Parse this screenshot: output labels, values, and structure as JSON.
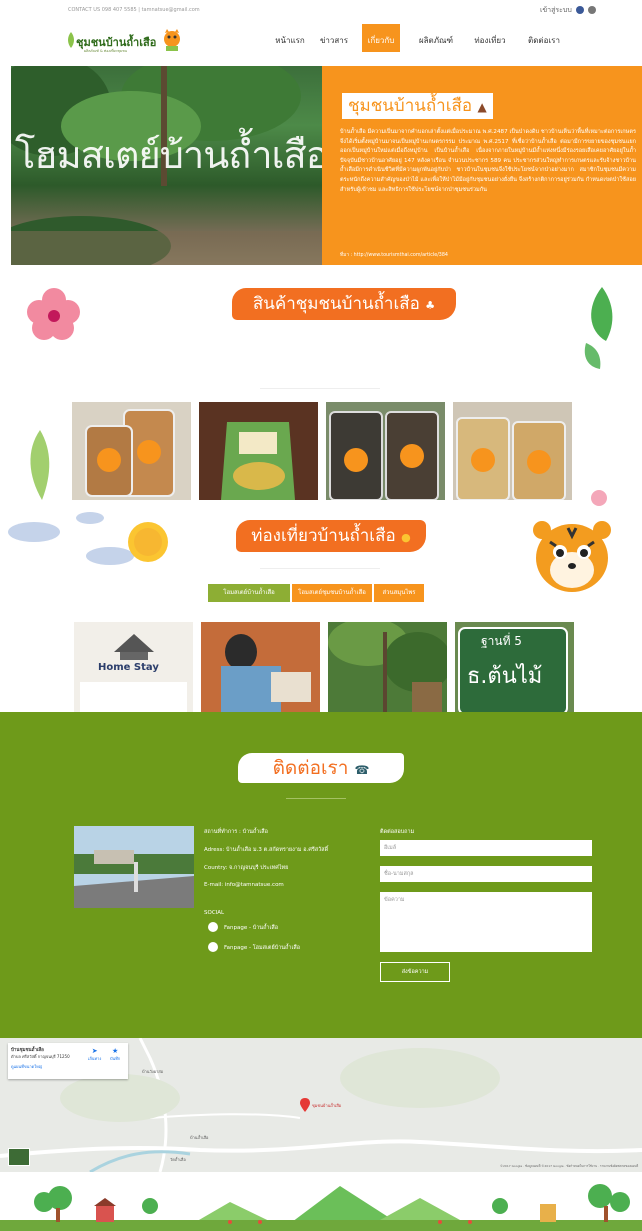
{
  "topbar": {
    "contact": "CONTACT US 098 407 5585 | tamnatsue@gmail.com",
    "member": "เข้าสู่ระบบ"
  },
  "logo": {
    "text": "ชุมชนบ้านถ้ำเสือ",
    "sub": "ผลิตภัณฑ์ & ท่องเที่ยวชุมชน"
  },
  "nav": {
    "items": [
      "หน้าแรก",
      "ข่าวสาร",
      "เกี่ยวกับ",
      "ผลิตภัณฑ์",
      "ท่องเที่ยว",
      "ติดต่อเรา"
    ],
    "active_index": 2
  },
  "hero": {
    "image_text": "โฮมสเตย์บ้านถ้ำเสือ",
    "title": "ชุมชนบ้านถ้ำเสือ",
    "body": "บ้านถ้ำเสือ มีความเป็นมาจากคำบอกเล่าตั้งแต่เมื่อประมาณ พ.ศ.2487 เป็นป่าดงดิบ ชาวบ้านเห็นว่าพื้นที่เหมาะต่อการเกษตรจึงได้เริ่มตั้งหมู่บ้านมาจนเป็นหมู่บ้านเกษตรกรรม ประมาณ พ.ศ.2517 ที่เชื่อว่าบ้านถ้ำเสือ ต่อมามีการขยายของชุมชนแยกออกเป็นหมู่บ้านใหม่แต่เมื่อถึงหมู่บ้าน เป็นบ้านถ้ำเสือ เนื่องจากภายในหมู่บ้านมีถ้ำแห่งหนึ่งมีร่องรอยเสือเคยอาศัยอยู่ในถ้ำ ปัจจุบันมีชาวบ้านอาศัยอยู่ 147 หลังคาเรือน จำนวนประชากร 589 คน ประชากรส่วนใหญ่ทำการเกษตรและรับจ้างชาวบ้านถ้ำเสือมีการดำเนินชีวิตที่มีความผูกพันอยู่กับป่า ชาวบ้านในชุมชนจึงใช้ประโยชน์จากป่าอย่างมาก สมาชิกในชุมชนมีความตระหนักถึงความสำคัญของป่าไม้ และเพื่อให้ป่าไม้มีอยู่กับชุมชนอย่างยั่งยืน จึงสร้างกติกาการอยู่ร่วมกัน กำหนดเขตป่าใช้สอยสำหรับผู้เข้าชม และสิทธิการใช้ประโยชน์จากป่าชุมชนร่วมกัน",
    "source": "ที่มา : http://www.tourismthai.com/article/384"
  },
  "products": {
    "title": "สินค้าชุมชนบ้านถ้ำเสือ"
  },
  "tourism": {
    "title": "ท่องเที่ยวบ้านถ้ำเสือ",
    "tabs": [
      "โฮมสเตย์บ้านถ้ำเสือ",
      "โฮมสเตย์ชุมชนบ้านถ้ำเสือ",
      "ส่วนสมุนไพร"
    ],
    "active_tab": 0,
    "homestay_sign": "Home Stay",
    "station_sign_top": "ฐานที่ 5",
    "station_sign_bottom": "ธ.ต้นไม้"
  },
  "contact": {
    "title": "ติดต่อเรา",
    "place": "สถานที่ทำการ : บ้านถ้ำเสือ",
    "address": "Adress: บ้านถ้ำเสือ ม.3 ต.สกัดทรายงาม อ.ศรีสวัสดิ์",
    "country": "Country: จ.กาญจนบุรี ประเทศไทย",
    "email": "E-mail: info@tamnatsue.com",
    "social_label": "SOCIAL",
    "social_links": [
      "Fanpage - บ้านถ้ำเสือ",
      "Fanpage - โฮมสเตย์บ้านถ้ำเสือ"
    ],
    "form_title": "ติดต่อสอบถาม",
    "fields": [
      "อีเมล์",
      "ชื่อ-นามสกุล",
      "ข้อความ"
    ],
    "send": "ส่งข้อความ"
  },
  "map": {
    "card_title": "บ้านชุมชนถ้ำเสือ",
    "card_addr": "ตำบล ศรีสวัสดิ์ กาญจนบุรี 71250",
    "card_link": "ดูแผนที่ขนาดใหญ่",
    "directions": "เส้นทาง",
    "save": "บันทึก",
    "pin_label": "ชุมชนบ้านถ้ำเสือ",
    "places": [
      "บ้านวังผาส่อ",
      "บ้านถ้ำเสือ",
      "วัดถ้ำเสือ"
    ],
    "copyright": "©2017 Google · ข้อมูลแผนที่ ©2017 Google · ข้อกำหนดในการใช้งาน · รายงานข้อผิดพลาดของแผนที่"
  },
  "colors": {
    "orange": "#f7941d",
    "green": "#6e9a1a"
  }
}
